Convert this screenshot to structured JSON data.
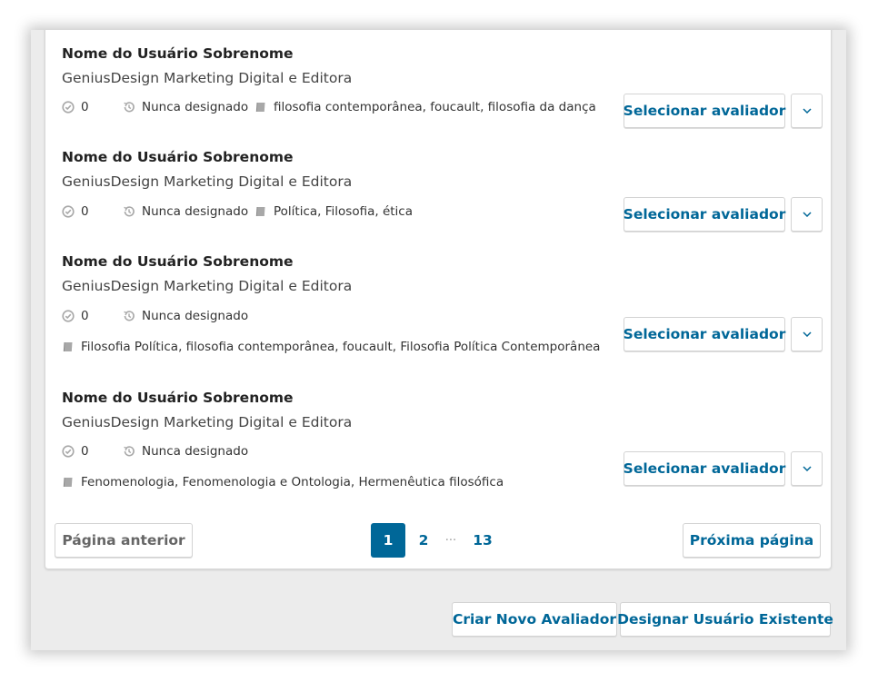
{
  "reviewers": [
    {
      "name": "Nome do Usuário Sobrenome",
      "affiliation": "GeniusDesign Marketing Digital e Editora",
      "completed": "0",
      "last_assigned": "Nunca designado",
      "interests": "filosofia contemporânea, foucault, filosofia da dança",
      "select_label": "Selecionar avaliador"
    },
    {
      "name": "Nome do Usuário Sobrenome",
      "affiliation": "GeniusDesign Marketing Digital e Editora",
      "completed": "0",
      "last_assigned": "Nunca designado",
      "interests": "Política, Filosofia, ética",
      "select_label": "Selecionar avaliador"
    },
    {
      "name": "Nome do Usuário Sobrenome",
      "affiliation": "GeniusDesign Marketing Digital e Editora",
      "completed": "0",
      "last_assigned": "Nunca designado",
      "interests": "Filosofia Política, filosofia contemporânea, foucault, Filosofia Política Contemporânea",
      "select_label": "Selecionar avaliador"
    },
    {
      "name": "Nome do Usuário Sobrenome",
      "affiliation": "GeniusDesign Marketing Digital e Editora",
      "completed": "0",
      "last_assigned": "Nunca designado",
      "interests": "Fenomenologia, Fenomenologia e Ontologia, Hermenêutica filosófica",
      "select_label": "Selecionar avaliador"
    }
  ],
  "pagination": {
    "prev_label": "Página anterior",
    "next_label": "Próxima página",
    "pages": [
      "1",
      "2",
      "···",
      "13"
    ],
    "current_page": "1"
  },
  "footer": {
    "create_label": "Criar Novo Avaliador",
    "assign_label": "Designar Usuário Existente"
  },
  "colors": {
    "primary": "#006798",
    "text": "#222222",
    "muted_icon": "#a8a8a8",
    "disabled_text": "#666666"
  },
  "icons": {
    "completed": "check-circle-icon",
    "history": "history-icon",
    "interests": "book-icon",
    "dropdown": "chevron-down-icon"
  }
}
